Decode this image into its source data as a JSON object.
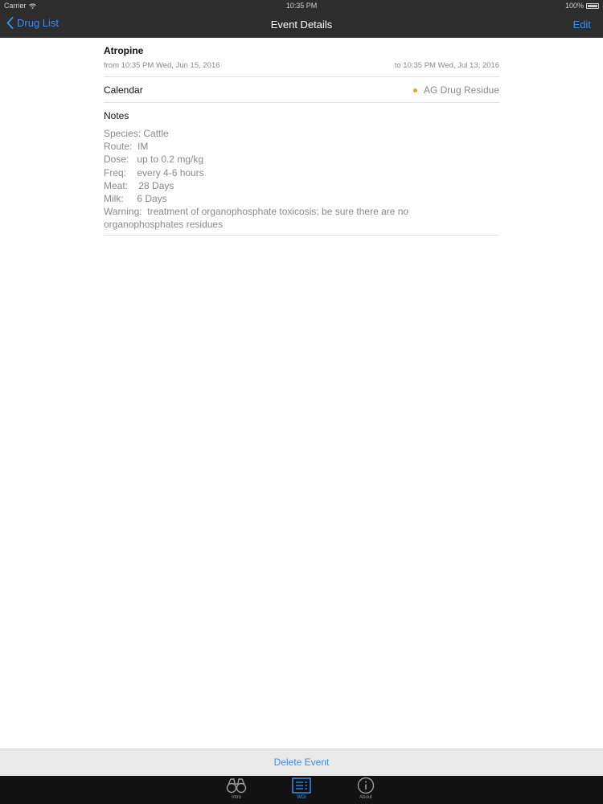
{
  "status": {
    "carrier": "Carrier",
    "time": "10:35 PM",
    "battery": "100%"
  },
  "nav": {
    "back_label": "Drug List",
    "title": "Event Details",
    "edit_label": "Edit"
  },
  "event": {
    "title": "Atropine",
    "from": "from 10:35 PM Wed, Jun 15, 2016",
    "to": "to 10:35 PM Wed, Jul 13, 2016"
  },
  "calendar": {
    "label": "Calendar",
    "value": "AG Drug Residue",
    "dot_color": "#f0a030"
  },
  "notes": {
    "label": "Notes",
    "lines": [
      "Species: Cattle",
      "Route:  IM",
      "Dose:   up to 0.2 mg/kg",
      "Freq:    every 4-6 hours",
      "Meat:    28 Days",
      "Milk:     6 Days",
      "Warning:  treatment of organophosphate toxicosis; be sure there are no",
      "organophosphates residues"
    ]
  },
  "toolbar": {
    "delete_label": "Delete Event"
  },
  "tabs": [
    {
      "label": "Intro",
      "icon": "binoculars-icon",
      "active": false
    },
    {
      "label": "WDI",
      "icon": "list-icon",
      "active": true
    },
    {
      "label": "About",
      "icon": "info-icon",
      "active": false
    }
  ],
  "colors": {
    "accent": "#3b8ef0",
    "bar": "#2d2d2d",
    "tabbar": "#121212"
  }
}
